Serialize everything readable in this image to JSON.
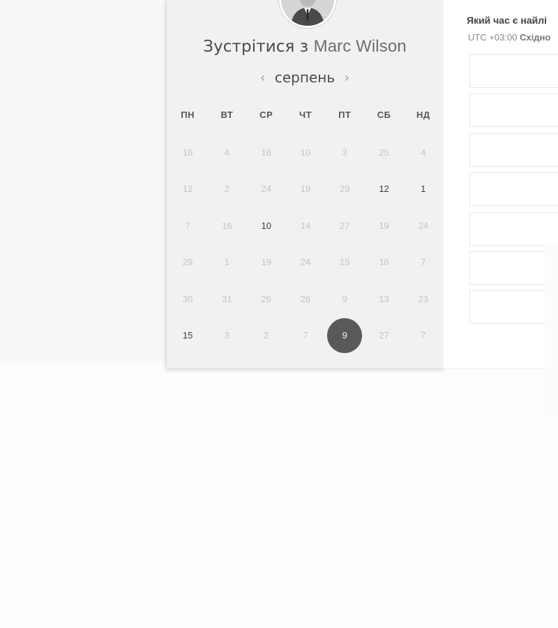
{
  "meeting": {
    "title_prefix": "Зустрітися з",
    "host_name": "Marc Wilson"
  },
  "calendar": {
    "month": "серпень",
    "prev_icon": "chevron-left-icon",
    "next_icon": "chevron-right-icon",
    "weekdays": [
      "ПН",
      "ВТ",
      "СР",
      "ЧТ",
      "ПТ",
      "СБ",
      "НД"
    ],
    "weeks": [
      [
        {
          "d": "16",
          "a": false
        },
        {
          "d": "4",
          "a": false
        },
        {
          "d": "16",
          "a": false
        },
        {
          "d": "10",
          "a": false
        },
        {
          "d": "3",
          "a": false
        },
        {
          "d": "25",
          "a": false
        },
        {
          "d": "4",
          "a": false
        }
      ],
      [
        {
          "d": "12",
          "a": false
        },
        {
          "d": "2",
          "a": false
        },
        {
          "d": "24",
          "a": false
        },
        {
          "d": "19",
          "a": false
        },
        {
          "d": "29",
          "a": false
        },
        {
          "d": "12",
          "a": true
        },
        {
          "d": "1",
          "a": true
        }
      ],
      [
        {
          "d": "7",
          "a": false
        },
        {
          "d": "16",
          "a": false
        },
        {
          "d": "10",
          "a": true
        },
        {
          "d": "14",
          "a": false
        },
        {
          "d": "27",
          "a": false
        },
        {
          "d": "19",
          "a": false
        },
        {
          "d": "24",
          "a": false
        }
      ],
      [
        {
          "d": "29",
          "a": false
        },
        {
          "d": "1",
          "a": false
        },
        {
          "d": "19",
          "a": false
        },
        {
          "d": "24",
          "a": false
        },
        {
          "d": "15",
          "a": false
        },
        {
          "d": "18",
          "a": false
        },
        {
          "d": "7",
          "a": false
        }
      ],
      [
        {
          "d": "30",
          "a": false
        },
        {
          "d": "31",
          "a": false
        },
        {
          "d": "26",
          "a": false
        },
        {
          "d": "26",
          "a": false
        },
        {
          "d": "9",
          "a": false
        },
        {
          "d": "13",
          "a": false
        },
        {
          "d": "23",
          "a": false
        }
      ],
      [
        {
          "d": "15",
          "a": true
        },
        {
          "d": "3",
          "a": false
        },
        {
          "d": "2",
          "a": false
        },
        {
          "d": "7",
          "a": false
        },
        {
          "d": "9",
          "a": true,
          "selected": true
        },
        {
          "d": "27",
          "a": false
        },
        {
          "d": "7",
          "a": false
        }
      ]
    ],
    "colors": {
      "selected_bg": "#595959",
      "active_text": "#3d3d3d",
      "inactive_text": "#c4c4c4",
      "panel_bg": "#f1f1f1"
    }
  },
  "time": {
    "question": "Який час є найлі",
    "tz_offset": "UTC +03:00",
    "tz_name": "Східно",
    "slot_count": 7
  }
}
